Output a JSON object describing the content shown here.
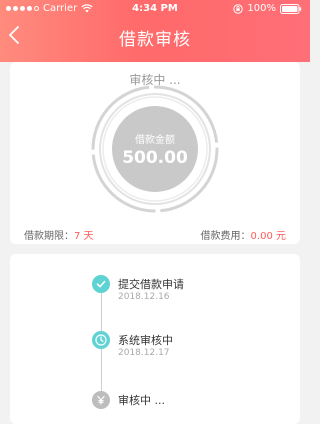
{
  "status_bar": {
    "carrier": "Carrier",
    "time": "4:34 PM",
    "battery": "100%"
  },
  "nav": {
    "title": "借款审核"
  },
  "summary": {
    "progress_label": "审核中 ...",
    "amount_caption": "借款金额",
    "amount": "500.00",
    "term_label": "借款期限：",
    "term_value": "7 天",
    "fee_label": "借款费用：",
    "fee_value": "0.00 元"
  },
  "timeline": {
    "steps": [
      {
        "title": "提交借款申请",
        "date": "2018.12.16",
        "status": "done",
        "icon": "check-icon"
      },
      {
        "title": "系统审核中",
        "date": "2018.12.17",
        "status": "current",
        "icon": "clock-icon"
      },
      {
        "title": "审核中 ...",
        "date": "",
        "status": "pending",
        "icon": "yen-icon"
      }
    ]
  },
  "colors": {
    "header_start": "#ff8b7d",
    "header_end": "#ff6f77",
    "accent_teal": "#5fd3d3",
    "highlight_red": "#ff5b5b",
    "dial_gray": "#c9c9c9"
  }
}
